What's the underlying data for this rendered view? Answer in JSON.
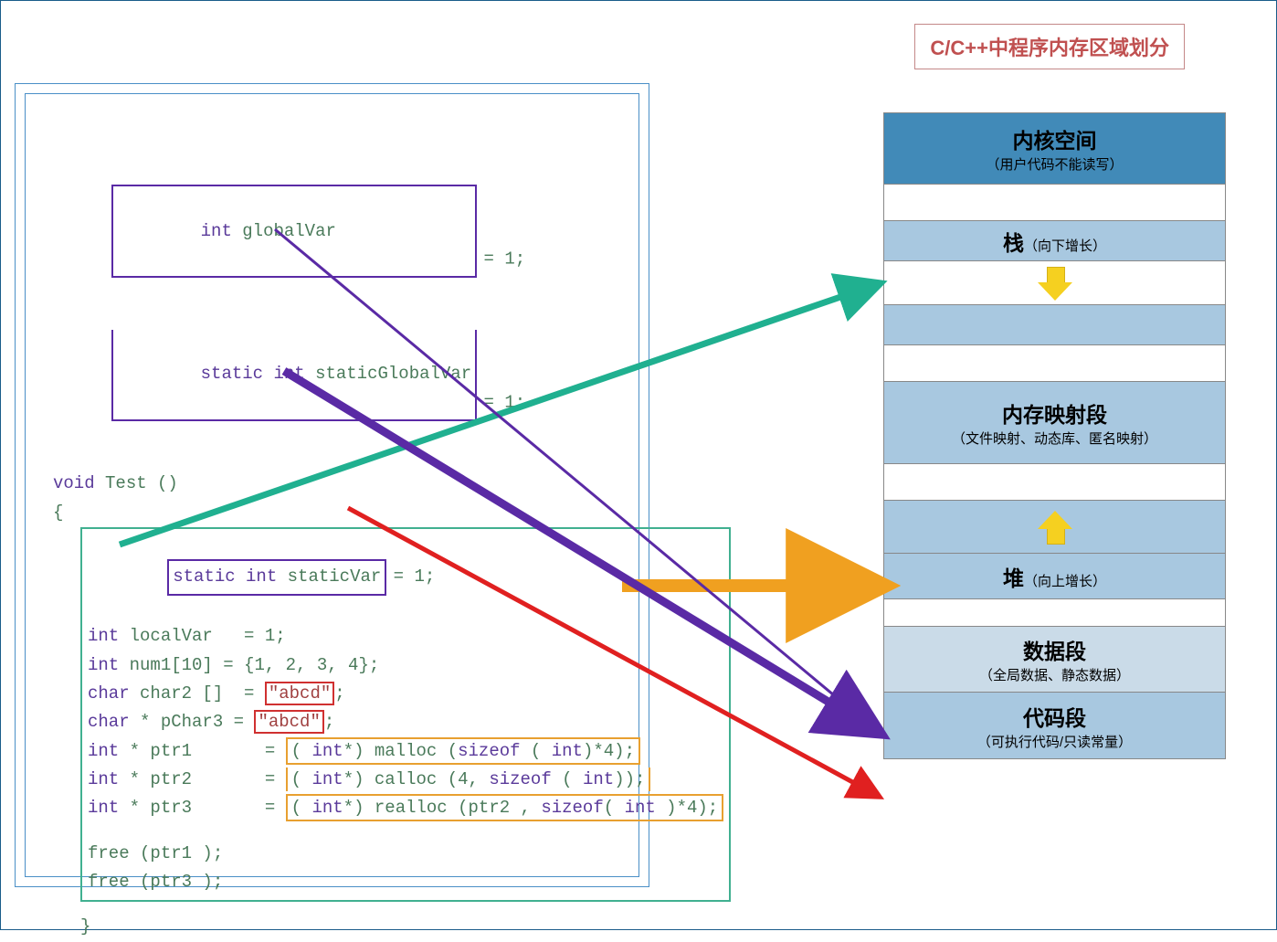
{
  "title": "C/C++中程序内存区域划分",
  "code": {
    "line1_left": "int globalVar",
    "line1_right": " = 1;",
    "line2_left": "static int staticGlobalVar",
    "line2_right": " = 1;",
    "func": "void Test ()",
    "brace_open": "{",
    "static_var_left": "static int staticVar",
    "static_var_right": " = 1;",
    "local1": "int localVar   = 1;",
    "local2": "int num1[10]  = {1, 2, 3, 4};",
    "char2_pre": "char char2 []  = ",
    "char2_str": "\"abcd\"",
    "char2_post": ";",
    "pchar3_pre": "char * pChar3 = ",
    "pchar3_str": "\"abcd\"",
    "pchar3_post": ";",
    "ptr1_pre": "int * ptr1       = ",
    "ptr1_body": "( int*) malloc (sizeof ( int)*4);",
    "ptr2_pre": "int * ptr2       = ",
    "ptr2_body": "( int*) calloc (4, sizeof ( int));",
    "ptr3_pre": "int * ptr3       = ",
    "ptr3_body": "( int*) realloc (ptr2 , sizeof( int )*4);",
    "free1": "free (ptr1 );",
    "free2": "free (ptr3 );",
    "brace_close": "}"
  },
  "memory": {
    "kernel_title": "内核空间",
    "kernel_sub": "（用户代码不能读写）",
    "stack_title": "栈",
    "stack_sub": "（向下增长）",
    "mmap_title": "内存映射段",
    "mmap_sub": "（文件映射、动态库、匿名映射）",
    "heap_title": "堆",
    "heap_sub": "（向上增长）",
    "data_title": "数据段",
    "data_sub": "（全局数据、静态数据）",
    "code_title": "代码段",
    "code_sub": "（可执行代码/只读常量）"
  }
}
